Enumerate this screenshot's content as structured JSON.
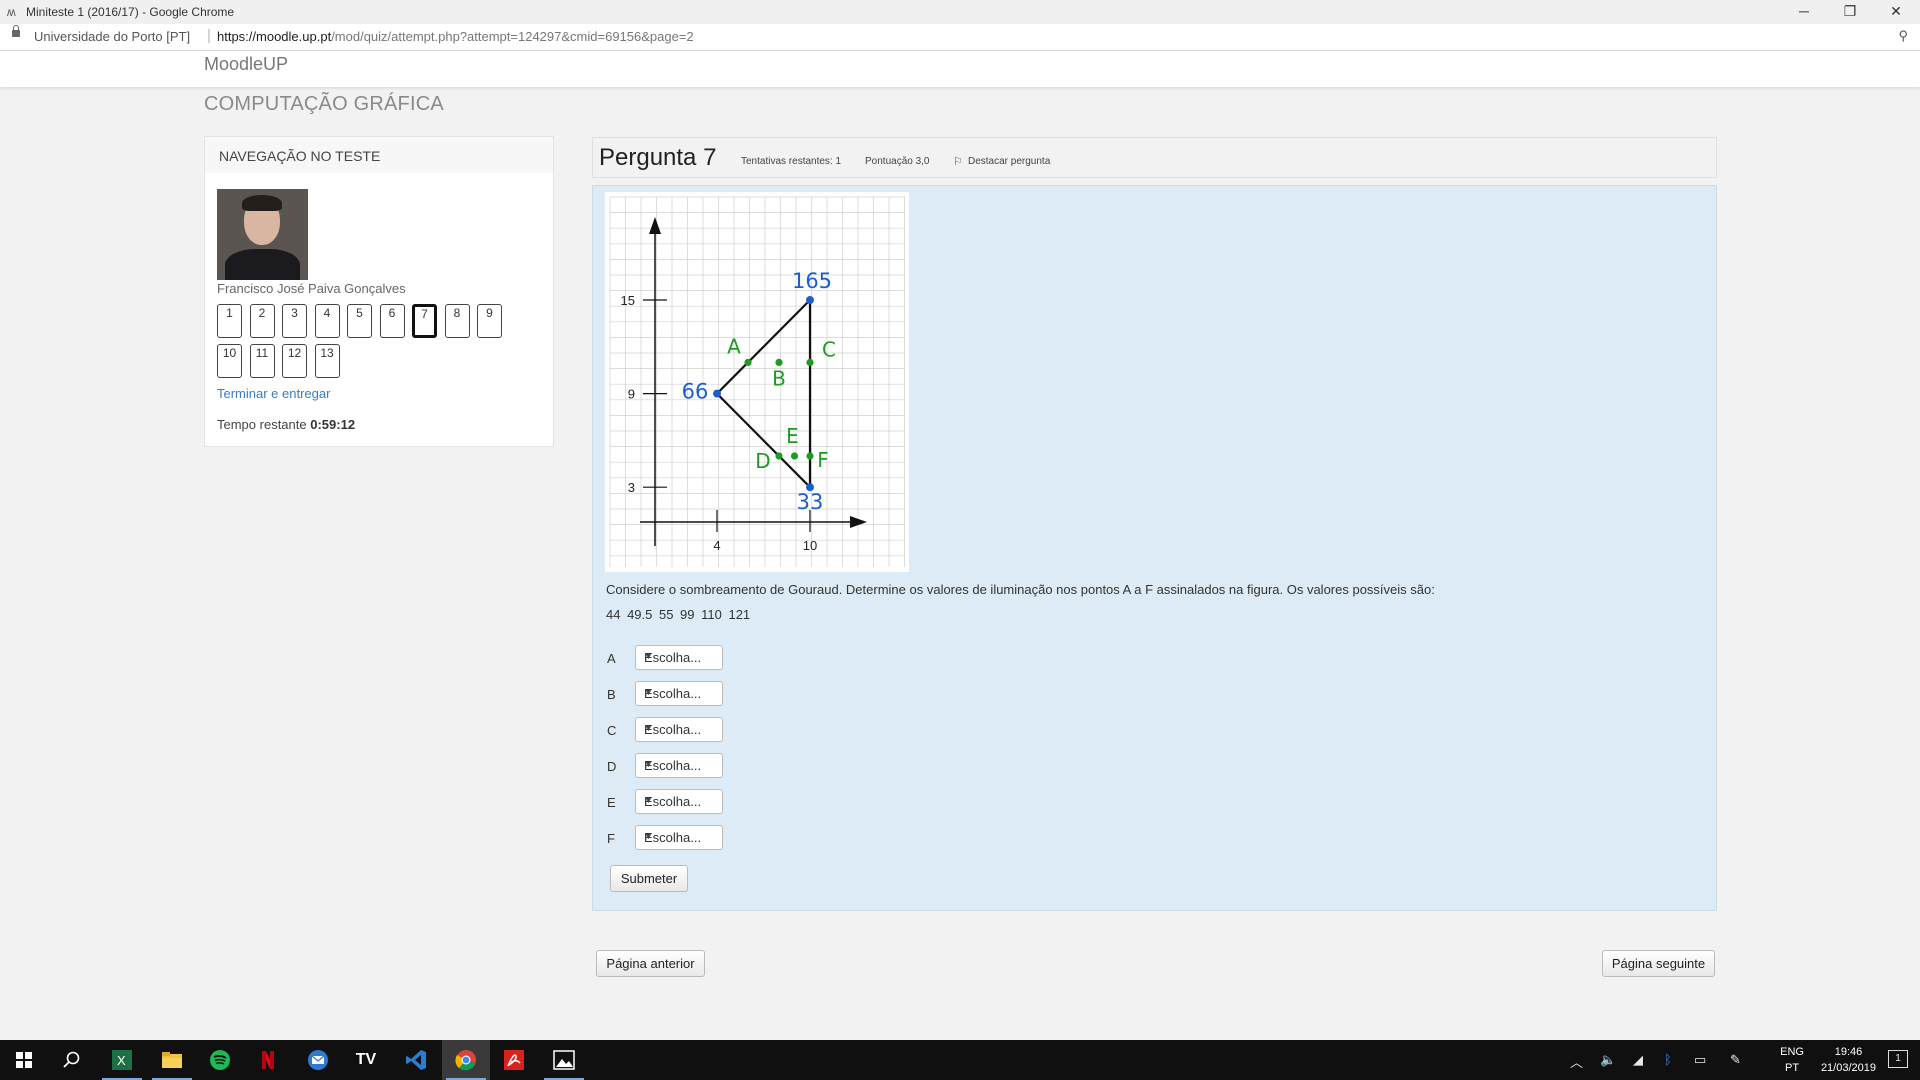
{
  "window": {
    "title": "Miniteste 1 (2016/17) - Google Chrome",
    "app_icon": "moodle-icon",
    "minimize": "─",
    "restore": "❐",
    "close": "✕"
  },
  "address": {
    "origin": "Universidade do Porto [PT]",
    "url_host": "https://moodle.up.pt",
    "url_path": "/mod/quiz/attempt.php?attempt=124297&cmid=69156&page=2",
    "zoom_icon": "magnifier-icon"
  },
  "site": {
    "brand": "MoodleUP",
    "course_title": "COMPUTAÇÃO GRÁFICA"
  },
  "nav_block": {
    "header": "NAVEGAÇÃO NO TESTE",
    "user_name": "Francisco José Paiva Gonçalves",
    "questions": [
      "1",
      "2",
      "3",
      "4",
      "5",
      "6",
      "7",
      "8",
      "9",
      "10",
      "11",
      "12",
      "13"
    ],
    "current_question": "7",
    "finish_link": "Terminar e entregar",
    "time_label": "Tempo restante",
    "time_value": "0:59:12"
  },
  "question": {
    "title": "Pergunta 7",
    "attempts": "Tentativas restantes: 1",
    "score": "Pontuação 3,0",
    "flag": "Destacar pergunta",
    "text": "Considere o sombreamento de Gouraud. Determine os valores de iluminação nos pontos A a F assinalados na figura. Os valores possíveis são:",
    "values": "44  49.5  55  99  110  121",
    "answers": [
      {
        "label": "A",
        "value": "Escolha..."
      },
      {
        "label": "B",
        "value": "Escolha..."
      },
      {
        "label": "C",
        "value": "Escolha..."
      },
      {
        "label": "D",
        "value": "Escolha..."
      },
      {
        "label": "E",
        "value": "Escolha..."
      },
      {
        "label": "F",
        "value": "Escolha..."
      }
    ],
    "submit": "Submeter"
  },
  "figure": {
    "y_ticks": [
      "15",
      "9",
      "3"
    ],
    "x_ticks": [
      "4",
      "10"
    ],
    "vertices": [
      {
        "label": "165",
        "x": 10,
        "y": 15
      },
      {
        "label": "66",
        "x": 4,
        "y": 9
      },
      {
        "label": "33",
        "x": 10,
        "y": 3
      }
    ],
    "points": [
      {
        "label": "A",
        "x": 6,
        "y": 11
      },
      {
        "label": "B",
        "x": 8,
        "y": 11
      },
      {
        "label": "C",
        "x": 10,
        "y": 11
      },
      {
        "label": "D",
        "x": 8,
        "y": 5
      },
      {
        "label": "E",
        "x": 9,
        "y": 5
      },
      {
        "label": "F",
        "x": 10,
        "y": 5
      }
    ],
    "colors": {
      "vertex": "#1a5fd0",
      "point": "#1f9a22",
      "grid": "#d0d0d0"
    }
  },
  "paging": {
    "prev": "Página anterior",
    "next": "Página seguinte"
  },
  "taskbar": {
    "apps": [
      "windows-start-icon",
      "search-icon",
      "excel-icon",
      "file-explorer-icon",
      "spotify-icon",
      "netflix-icon",
      "mail-icon",
      "tv-icon",
      "vscode-icon",
      "chrome-icon",
      "acrobat-icon",
      "photos-icon"
    ],
    "tv_label": "TV",
    "lang_top": "ENG",
    "lang_bottom": "PT",
    "time": "19:46",
    "date": "21/03/2019",
    "notif_count": "1"
  }
}
